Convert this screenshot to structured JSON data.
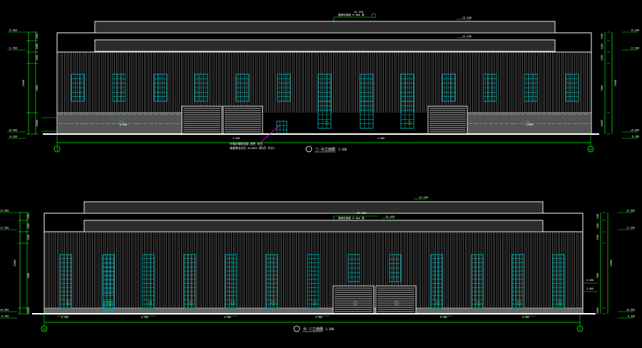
{
  "colors": {
    "background": "#000000",
    "linework": "#ffffff",
    "dimension": "#00ff00",
    "glazing": "#00b0b0",
    "leader": "#ff00ff",
    "label": "#e0e000"
  },
  "elevation_top": {
    "title": "①-⑯立面图",
    "scale": "1:100",
    "axis_left": "1",
    "axis_right": "16",
    "roof_note": "屋面彩钢板 0.6mm 厚",
    "roof_level": "15.450",
    "ridge_level": "13.200",
    "notes": [
      "外墙彩钢板墙面 颜色 米白",
      "坡道做法详见 02J003 第5页 节点1"
    ],
    "left_levels": [
      "15.000",
      "11.500",
      "±0.000",
      "-0.300"
    ],
    "right_levels": [
      "15.000",
      "11.500",
      "±0.000",
      "-0.300"
    ],
    "left_dims": [
      "3500",
      "2400",
      "1500",
      "3900",
      "15000"
    ],
    "right_dims": [
      "3500",
      "2400",
      "1500",
      "3900",
      "15000"
    ],
    "side_labels": [
      "0.900",
      "1.800"
    ],
    "base_labels": [
      "4.500",
      "4.500"
    ]
  },
  "elevation_bottom": {
    "title": "⑯-①立面图",
    "scale": "1:100",
    "axis_left": "16",
    "axis_right": "1",
    "roof_note": "屋面彩钢板 0.6mm 厚",
    "roof_level": "15.450",
    "ridge_level": "13.200",
    "left_levels": [
      "15.000",
      "11.500",
      "±0.000",
      "-0.300"
    ],
    "right_levels": [
      "15.000",
      "11.500",
      "±0.000",
      "-0.300"
    ],
    "left_dims": [
      "3500",
      "2400",
      "1500",
      "3900",
      "15000"
    ],
    "right_dims": [
      "3500",
      "2400",
      "1500",
      "3900",
      "15000"
    ],
    "side_labels": [
      "4.500",
      "3.000"
    ],
    "base_labels": [
      "0.900",
      "0.900",
      "0.900",
      "0.900",
      "0.900",
      "0.900"
    ]
  }
}
